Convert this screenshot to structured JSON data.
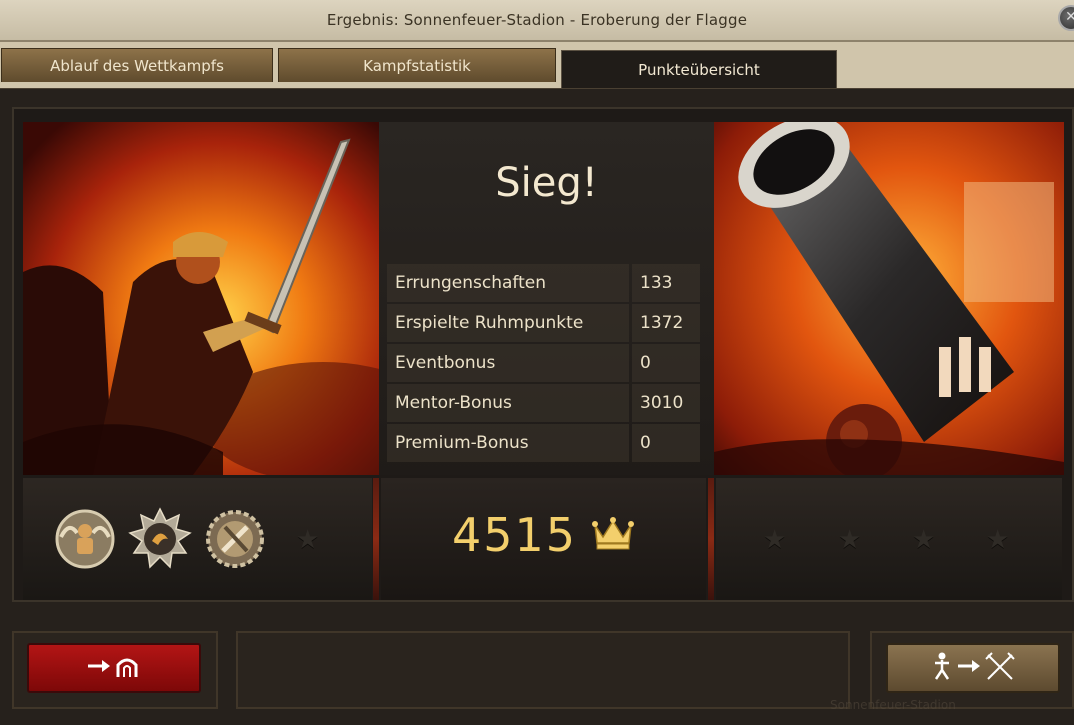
{
  "window": {
    "title": "Ergebnis: Sonnenfeuer-Stadion - Eroberung der Flagge",
    "close_icon": "close-icon"
  },
  "tabs": [
    {
      "label": "Ablauf des Wettkampfs",
      "active": false
    },
    {
      "label": "Kampfstatistik",
      "active": false
    },
    {
      "label": "Punkteübersicht",
      "active": true
    }
  ],
  "result": {
    "headline": "Sieg!",
    "stats": [
      {
        "label": "Errungenschaften",
        "value": "133"
      },
      {
        "label": "Erspielte Ruhmpunkte",
        "value": "1372"
      },
      {
        "label": "Eventbonus",
        "value": "0"
      },
      {
        "label": "Mentor-Bonus",
        "value": "3010"
      },
      {
        "label": "Premium-Bonus",
        "value": "0"
      }
    ],
    "total": "4515",
    "total_icon": "crown-icon"
  },
  "medals_left": [
    "mentor-medal-icon",
    "sun-medal-icon",
    "tools-medal-icon"
  ],
  "empty_slots_left": 1,
  "empty_slots_right": 4,
  "footer": {
    "leave_button_icon": "exit-arena-icon",
    "join_button_icon": "join-battle-icon",
    "watermark": "Sonnenfeuer-Stadion"
  },
  "colors": {
    "accent_gold": "#f3cf6c",
    "leave_button": "#b31515",
    "join_button": "#8a7350"
  }
}
